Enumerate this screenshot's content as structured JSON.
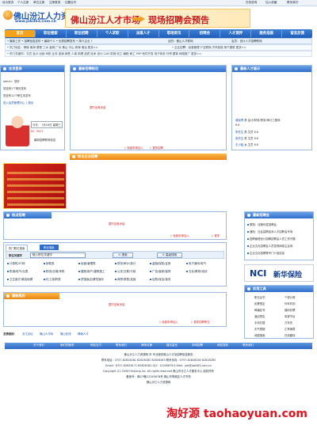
{
  "topbar": {
    "items": [
      "设为首页",
      "个人注册",
      "单位注册",
      "注册登录",
      "加盟合作"
    ],
    "right": [
      "在线咨询",
      "加入收藏",
      "联系我们"
    ]
  },
  "header": {
    "logo_cn": "佛山汾江人力资源网",
    "logo_url": "www.job363.com.cn",
    "banner_left": "佛山汾江人才市场",
    "banner_right": "现场招聘会预告"
  },
  "nav": [
    "首页",
    "职位搜索",
    "职位招聘",
    "个人求职",
    "派遣人才",
    "职场资讯",
    "招聘会",
    "人才测评",
    "服务指南",
    "留言反馈"
  ],
  "subnav": {
    "left": "• 最新工作 • 招聘信息发布 • 最新个人 • 优秀招聘发布 • 简介企业 ↑",
    "mid": "目的：佛山人才联网",
    "right": "会员：设计人才招聘联网"
  },
  "row2": {
    "left": "• 热门地区：禅城 南海 顺德 三水 高明 广州 佛山 中山 珠海 清远 更多>>",
    "right": "• 企业招聘：经营管理 IT互联网 汽车制造 房产建筑 更多>>"
  },
  "row3": {
    "text": "• 热门关键词：文员 会计 出纳 司机 业务 促销 销售 人事 助理 品质 技术 设计 CAD 机械 电工 编程 美工 PHP 软件开发 电子商务 外贸 跟单 网络推广 更多>>"
  },
  "member": {
    "title": "会员登录",
    "lines": [
      "admin：您好",
      "您还有1个简历发布",
      "您还有12个职位未发布",
      "进入会员管理中心 │ 退出"
    ],
    "date": "今天： 7月16日 星期三",
    "uid": "ID：9527",
    "note": "最新招聘联网信息"
  },
  "top_jobs": {
    "title": "最新招聘职位",
    "empty": "暂时没有消息",
    "apply": "》免费申请加入",
    "more": "》更多招聘"
  },
  "talent": {
    "title": "最新人才展示",
    "rows": [
      {
        "name": "戚晓青",
        "text": "男 会计/财务/税务/审计工程师"
      },
      {
        "name": "",
        "text": "6.6"
      },
      {
        "name": "李先生",
        "text": "男 文员 6.6"
      },
      {
        "name": "张先生",
        "text": "男 文员 6.6"
      },
      {
        "name": "王小姐",
        "text": "女 文员 6.6"
      }
    ]
  },
  "famous": {
    "title": "知名企业招聘"
  },
  "hot_jobs": {
    "title": "热点招聘",
    "empty": "暂时没有消息",
    "apply": "》免费申请加入",
    "more": "》更多"
  },
  "search": {
    "tabs": [
      "热门职位搜索",
      "职业搜索"
    ],
    "keyword_label": "职位关键字",
    "placeholder": "输入职位关键字",
    "buttons": [
      "搜索",
      "高级搜索"
    ],
    "categories": [
      [
        "计算机/IT/网",
        "销售类",
        "经营/管理类",
        "财务/审计/统计",
        "金融/保险/证券",
        "电子通讯/电气"
      ],
      [
        "机械/电气/仪表",
        "物流/仓储/采购",
        "建筑/房产/建筑施工",
        "公关/文职/行政",
        "广告/装修/装饰",
        "文化/教育/培训"
      ],
      [
        "卫生医疗/美容保健",
        "化工/制药类",
        "宾馆饭店/餐饮娱乐",
        "商贸/零售/连锁",
        "后勤/保洁/保安",
        ""
      ]
    ]
  },
  "news_block": {
    "title": "最新招聘会",
    "items": [
      "联翔：佳粮利发招聘会",
      "通知：社会招聘技术人才招聘会专场",
      "招聘管理设计招聘招聘会人员工作开展",
      "企业文化招聘会人员发现网络主会场",
      "企业文化招聘等专门介绍信息"
    ]
  },
  "nci": {
    "brand": "NCI",
    "cn": "新华保险"
  },
  "tools": {
    "title": "实用工具",
    "items": [
      "职位证书",
      "个税计算",
      "机票预定",
      "列车时刻",
      "邮编区号",
      "福利彩票",
      "酒店预定",
      "电视节目",
      "手机归属",
      "万年历",
      "天气预报",
      "汇率换算",
      "地图搜索",
      "在线翻译"
    ]
  },
  "latest": {
    "title": "最新简历",
    "empty": "暂时没有消息",
    "apply": "》免费申请加入",
    "more": "》更多招聘职位"
  },
  "partners": {
    "label": "友情链接：",
    "links": [
      "汾江论坛",
      "佛山人才网",
      "佛山在线",
      "禅城人才"
    ]
  },
  "footer": {
    "links": [
      "关于我们",
      "我们的服务",
      "网站支付",
      "联系我们",
      "律师法律",
      "建议留言",
      "本网招聘",
      "网站导航",
      "联系我们"
    ],
    "lines": [
      "佛山汾江人力资源网 年 专业服务佛山人才及招聘信息服务",
      "联系电话：0757-82828281 82828282 82828283 联系传真：0757-82828284 82828285",
      "Email：8757-82828171 82828181  QQ：12345678 E-Mail：job@job363.com.cn",
      "Copyright (C) 2006 FenJiang Inc. All rights reserved 佛山市汾江人才服务中心 版权所有",
      "备案号：粤ICP备12345678号 佛山市禅城区人才市场",
      "佛山汾江人力资源网"
    ]
  },
  "watermark": "淘好源 taohaoyuan.com"
}
